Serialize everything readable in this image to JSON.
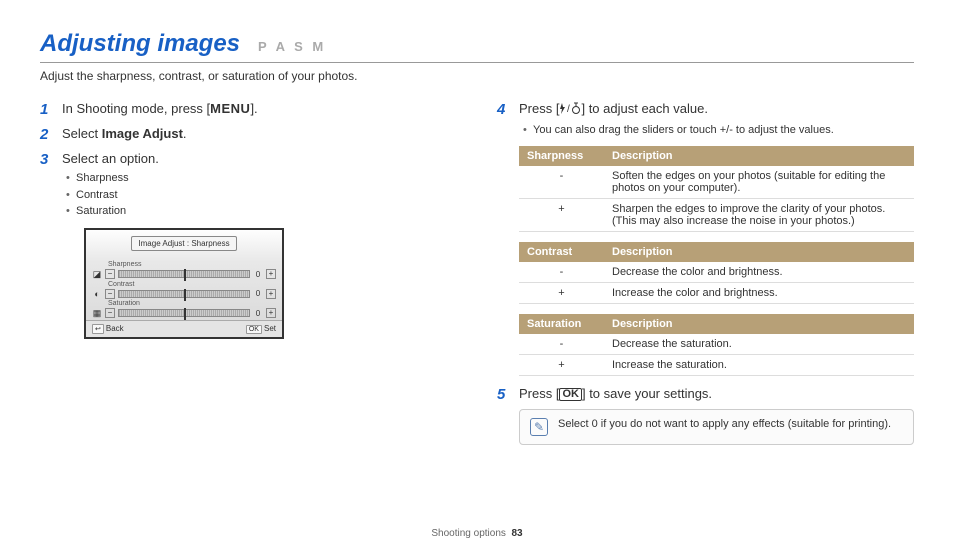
{
  "heading": {
    "title": "Adjusting images",
    "modes": "P A S M"
  },
  "subtitle": "Adjust the sharpness, contrast, or saturation of your photos.",
  "left": {
    "step1": {
      "pre": "In Shooting mode, press [",
      "btn": "MENU",
      "post": "]."
    },
    "step2": {
      "pre": "Select ",
      "bold": "Image Adjust",
      "post": "."
    },
    "step3": {
      "text": "Select an option.",
      "opts": [
        "Sharpness",
        "Contrast",
        "Saturation"
      ]
    },
    "lcd": {
      "tag": "Image Adjust : Sharpness",
      "rows": [
        {
          "label": "Sharpness",
          "val": "0"
        },
        {
          "label": "Contrast",
          "val": "0"
        },
        {
          "label": "Saturation",
          "val": "0"
        }
      ],
      "back": "Back",
      "set": "Set",
      "okLabel": "OK"
    }
  },
  "right": {
    "step4": {
      "pre": "Press [",
      "post": "] to adjust each value.",
      "note": "You can also drag the sliders or touch +/- to adjust the values."
    },
    "tables": {
      "sharpness": {
        "h1": "Sharpness",
        "h2": "Description",
        "rows": [
          {
            "k": "-",
            "v": "Soften the edges on your photos (suitable for editing the photos on your computer)."
          },
          {
            "k": "+",
            "v": "Sharpen the edges to improve the clarity of your photos. (This may also increase the noise in your photos.)"
          }
        ]
      },
      "contrast": {
        "h1": "Contrast",
        "h2": "Description",
        "rows": [
          {
            "k": "-",
            "v": "Decrease the color and brightness."
          },
          {
            "k": "+",
            "v": "Increase the color and brightness."
          }
        ]
      },
      "saturation": {
        "h1": "Saturation",
        "h2": "Description",
        "rows": [
          {
            "k": "-",
            "v": "Decrease the saturation."
          },
          {
            "k": "+",
            "v": "Increase the saturation."
          }
        ]
      }
    },
    "step5": {
      "pre": "Press [",
      "btn": "OK",
      "post": "] to save your settings."
    },
    "tip": "Select 0 if you do not want to apply any effects (suitable for printing)."
  },
  "footer": {
    "section": "Shooting options",
    "page": "83"
  }
}
